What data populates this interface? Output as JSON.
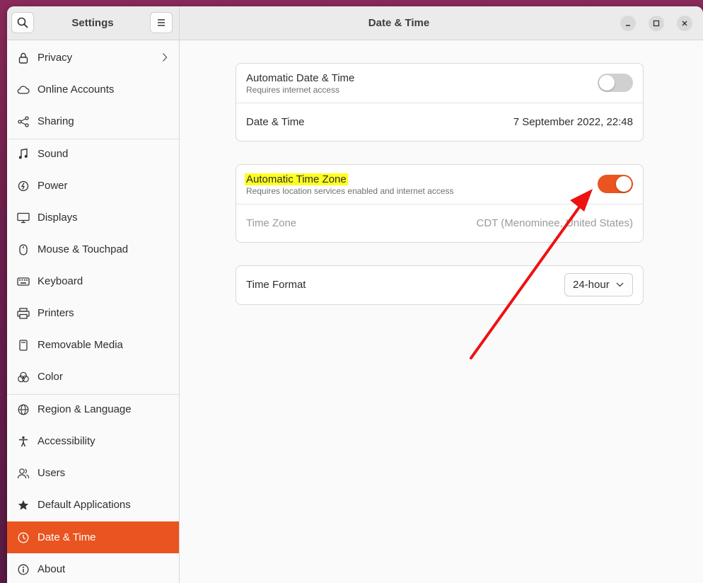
{
  "header": {
    "sidebar_title": "Settings",
    "title": "Date & Time"
  },
  "sidebar": {
    "items": [
      {
        "label": "Privacy",
        "icon": "lock-icon",
        "has_chevron": true
      },
      {
        "label": "Online Accounts",
        "icon": "cloud-icon"
      },
      {
        "label": "Sharing",
        "icon": "share-icon"
      },
      {
        "label": "Sound",
        "icon": "music-note-icon"
      },
      {
        "label": "Power",
        "icon": "power-icon"
      },
      {
        "label": "Displays",
        "icon": "display-icon"
      },
      {
        "label": "Mouse & Touchpad",
        "icon": "mouse-icon"
      },
      {
        "label": "Keyboard",
        "icon": "keyboard-icon"
      },
      {
        "label": "Printers",
        "icon": "printer-icon"
      },
      {
        "label": "Removable Media",
        "icon": "removable-media-icon"
      },
      {
        "label": "Color",
        "icon": "color-icon"
      },
      {
        "label": "Region & Language",
        "icon": "globe-icon"
      },
      {
        "label": "Accessibility",
        "icon": "accessibility-icon"
      },
      {
        "label": "Users",
        "icon": "users-icon"
      },
      {
        "label": "Default Applications",
        "icon": "star-icon"
      },
      {
        "label": "Date & Time",
        "icon": "clock-icon",
        "active": true
      },
      {
        "label": "About",
        "icon": "info-icon"
      }
    ]
  },
  "datetime_card": {
    "auto_datetime_title": "Automatic Date & Time",
    "auto_datetime_sub": "Requires internet access",
    "auto_datetime_enabled": false,
    "datetime_label": "Date & Time",
    "datetime_value": "7 September 2022, 22:48"
  },
  "timezone_card": {
    "auto_tz_title": "Automatic Time Zone",
    "auto_tz_sub": "Requires location services enabled and internet access",
    "auto_tz_enabled": true,
    "timezone_label": "Time Zone",
    "timezone_value": "CDT (Menominee, United States)"
  },
  "format_card": {
    "time_format_label": "Time Format",
    "time_format_value": "24-hour"
  },
  "colors": {
    "accent": "#e95420",
    "highlight": "#ffff22",
    "annotation_arrow": "#ee1111"
  }
}
